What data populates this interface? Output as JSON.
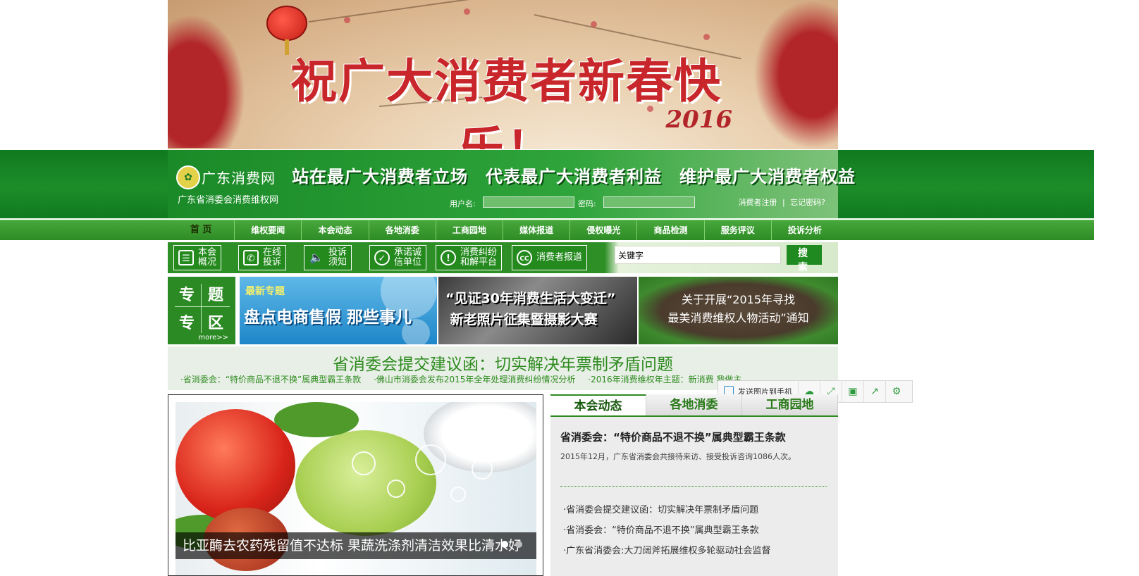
{
  "banner": {
    "greeting": "祝广大消费者新春快乐！",
    "year": "2016"
  },
  "header": {
    "site_name": "广东消费网",
    "site_subtitle": "广东省消委会消费维权网",
    "slogan": "站在最广大消费者立场　代表最广大消费者利益　维护最广大消费者权益",
    "username_label": "用户名:",
    "password_label": "密码:",
    "register_link": "消费者注册",
    "separator": "|",
    "forgot_link": "忘记密码?"
  },
  "nav": {
    "items": [
      "首  页",
      "维权要闻",
      "本会动态",
      "各地消委",
      "工商园地",
      "媒体报道",
      "侵权曝光",
      "商品检测",
      "服务评议",
      "投诉分析"
    ]
  },
  "quick": {
    "buttons": [
      {
        "label": "本会\n概况",
        "icon": "document-icon"
      },
      {
        "label": "在线\n投诉",
        "icon": "phone-icon"
      },
      {
        "label": "投诉\n须知",
        "icon": "speaker-icon"
      },
      {
        "label": "承诺诚\n信单位",
        "icon": "check-icon"
      },
      {
        "label": "消费纠纷\n和解平台",
        "icon": "alert-icon"
      },
      {
        "label": "消费者报道",
        "icon": "cc-reports-icon"
      }
    ],
    "search_value": "关键字",
    "search_button": "搜 索"
  },
  "topics": {
    "label_chars": [
      "专",
      "题",
      "专",
      "区"
    ],
    "more": "more>>",
    "cards": [
      {
        "tag": "最新专题",
        "title": "盘点电商售假 那些事儿"
      },
      {
        "title": "“见证30年消费生活大变迁”\n 新老照片征集暨摄影大赛"
      },
      {
        "title": "关于开展“2015年寻找\n最美消费维权人物活动”通知"
      }
    ]
  },
  "headline": {
    "title": "省消委会提交建议函：切实解决年票制矛盾问题",
    "links": [
      "·省消委会：“特价商品不退不换”属典型霸王条款",
      "·佛山市消委会发布2015年全年处理消费纠纷情况分析",
      "·2016年消费维权年主题：新消费 我做主"
    ]
  },
  "float_bar": {
    "send_label": "发送图片到手机",
    "icons": [
      "cloud-icon",
      "expand-icon",
      "save-icon",
      "share-icon",
      "settings-icon"
    ]
  },
  "slideshow": {
    "caption": "比亚酶去农药残留值不达标 果蔬洗涤剂清洁效果比清水好",
    "slide_count": 3,
    "active_index": 1
  },
  "news": {
    "tabs": [
      "本会动态",
      "各地消委",
      "工商园地"
    ],
    "active_tab": 0,
    "featured_title": "省消委会：“特价商品不退不换”属典型霸王条款",
    "featured_summary": "2015年12月，广东省消委会共接待来访、接受投诉咨询1086人次。",
    "items": [
      "·省消委会提交建议函：切实解决年票制矛盾问题",
      "·省消委会：“特价商品不退不换”属典型霸王条款",
      "·广东省消委会:大刀阔斧拓展维权多轮驱动社会监督"
    ]
  },
  "colors": {
    "primary_green": "#1d8d2a",
    "festive_red": "#c8262b"
  }
}
